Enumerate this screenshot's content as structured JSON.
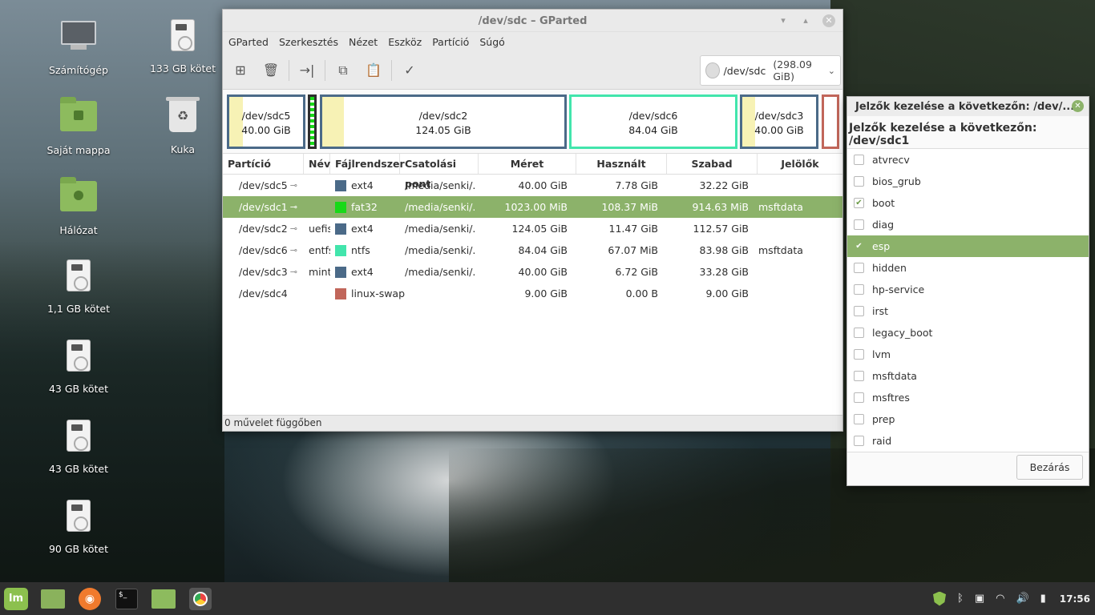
{
  "desktop": {
    "icons": [
      {
        "label": "Számítógép",
        "icon": "computer-icon"
      },
      {
        "label": "133 GB kötet",
        "icon": "drive-icon"
      },
      {
        "label": "Saját mappa",
        "icon": "home-folder-icon"
      },
      {
        "label": "Kuka",
        "icon": "trash-icon"
      },
      {
        "label": "Hálózat",
        "icon": "network-folder-icon"
      },
      {
        "label": "1,1 GB kötet",
        "icon": "drive-icon"
      },
      {
        "label": "43 GB kötet",
        "icon": "drive-icon"
      },
      {
        "label": "43 GB kötet",
        "icon": "drive-icon"
      },
      {
        "label": "90 GB kötet",
        "icon": "drive-icon"
      }
    ]
  },
  "gparted": {
    "title": "/dev/sdc – GParted",
    "menu": [
      "GParted",
      "Szerkesztés",
      "Nézet",
      "Eszköz",
      "Partíció",
      "Súgó"
    ],
    "device": {
      "name": "/dev/sdc",
      "size": "(298.09 GiB)"
    },
    "map": [
      {
        "name": "/dev/sdc5",
        "size": "40.00 GiB"
      },
      {
        "name": "/dev/sdc2",
        "size": "124.05 GiB"
      },
      {
        "name": "/dev/sdc6",
        "size": "84.04 GiB"
      },
      {
        "name": "/dev/sdc3",
        "size": "40.00 GiB"
      }
    ],
    "columns": [
      "Partíció",
      "Név",
      "Fájlrendszer",
      "Csatolási pont",
      "Méret",
      "Használt",
      "Szabad",
      "Jelölők"
    ],
    "rows": [
      {
        "partition": "/dev/sdc5",
        "name": "",
        "fs": "ext4",
        "mount": "/media/senki/...",
        "size": "40.00 GiB",
        "used": "7.78 GiB",
        "free": "32.22 GiB",
        "flags": ""
      },
      {
        "partition": "/dev/sdc1",
        "name": "",
        "fs": "fat32",
        "mount": "/media/senki/...",
        "size": "1023.00 MiB",
        "used": "108.37 MiB",
        "free": "914.63 MiB",
        "flags": "msftdata"
      },
      {
        "partition": "/dev/sdc2",
        "name": "uefis",
        "fs": "ext4",
        "mount": "/media/senki/...",
        "size": "124.05 GiB",
        "used": "11.47 GiB",
        "free": "112.57 GiB",
        "flags": ""
      },
      {
        "partition": "/dev/sdc6",
        "name": "entfs",
        "fs": "ntfs",
        "mount": "/media/senki/...",
        "size": "84.04 GiB",
        "used": "67.07 MiB",
        "free": "83.98 GiB",
        "flags": "msftdata"
      },
      {
        "partition": "/dev/sdc3",
        "name": "mint",
        "fs": "ext4",
        "mount": "/media/senki/...",
        "size": "40.00 GiB",
        "used": "6.72 GiB",
        "free": "33.28 GiB",
        "flags": ""
      },
      {
        "partition": "/dev/sdc4",
        "name": "",
        "fs": "linux-swap",
        "mount": "",
        "size": "9.00 GiB",
        "used": "0.00 B",
        "free": "9.00 GiB",
        "flags": ""
      }
    ],
    "status": "0 művelet függőben",
    "colors": {
      "ext4": "#4b6a88",
      "fat32": "#18d918",
      "ntfs": "#42e5ac",
      "linux-swap": "#c1665a",
      "selection": "#8cb26a"
    }
  },
  "flags_dialog": {
    "title": "Jelzők kezelése a következőn: /dev/...",
    "heading": "Jelzők kezelése a következőn: /dev/sdc1",
    "flags": [
      {
        "label": "atvrecv",
        "checked": false
      },
      {
        "label": "bios_grub",
        "checked": false
      },
      {
        "label": "boot",
        "checked": true
      },
      {
        "label": "diag",
        "checked": false
      },
      {
        "label": "esp",
        "checked": true
      },
      {
        "label": "hidden",
        "checked": false
      },
      {
        "label": "hp-service",
        "checked": false
      },
      {
        "label": "irst",
        "checked": false
      },
      {
        "label": "legacy_boot",
        "checked": false
      },
      {
        "label": "lvm",
        "checked": false
      },
      {
        "label": "msftdata",
        "checked": false
      },
      {
        "label": "msftres",
        "checked": false
      },
      {
        "label": "prep",
        "checked": false
      },
      {
        "label": "raid",
        "checked": false
      }
    ],
    "close_label": "Bezárás"
  },
  "panel": {
    "clock": "17:56",
    "terminal_prompt": "$_"
  }
}
